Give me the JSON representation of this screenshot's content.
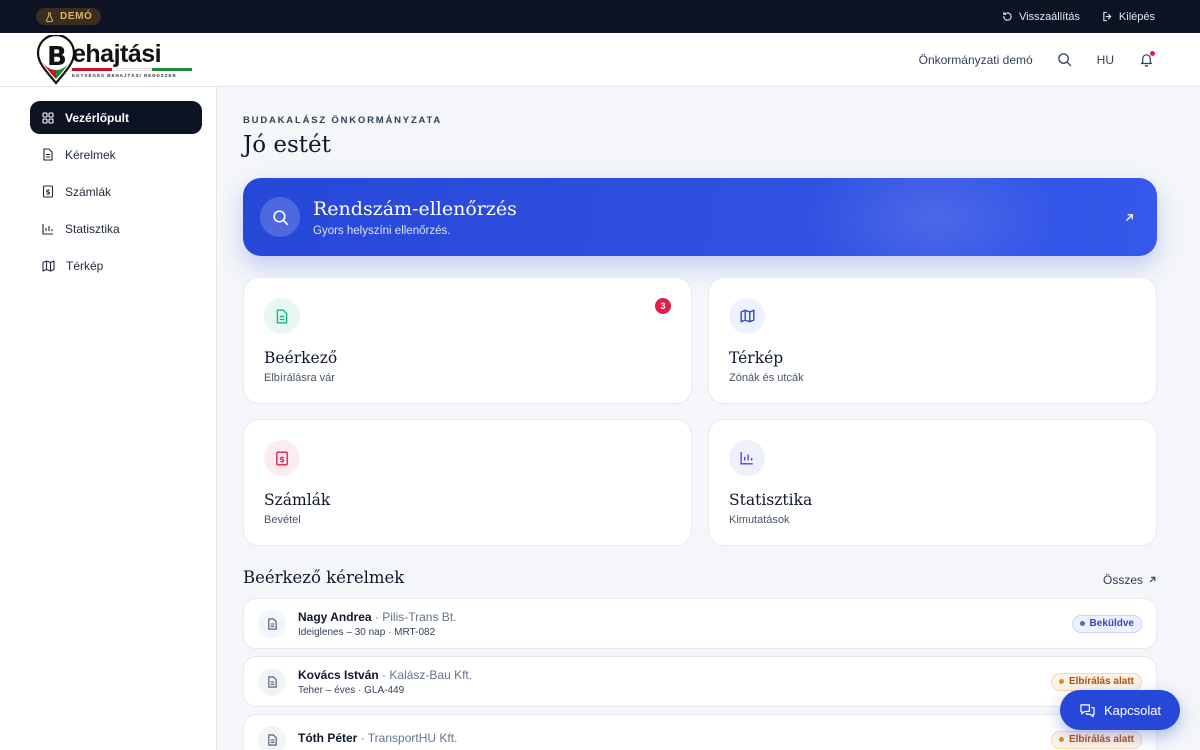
{
  "demobar": {
    "badge": "DEMÓ",
    "reset_label": "Visszaállítás",
    "logout_label": "Kilépés"
  },
  "header": {
    "logo_text": "ehajtási",
    "logo_subtitle": "EGYSÉGES BEHAJTÁSI RENDSZER",
    "account_label": "Önkormányzati demó",
    "language": "HU"
  },
  "sidebar": {
    "items": [
      {
        "label": "Vezérlőpult",
        "icon": "grid-icon",
        "active": true
      },
      {
        "label": "Kérelmek",
        "icon": "document-icon"
      },
      {
        "label": "Számlák",
        "icon": "invoice-icon"
      },
      {
        "label": "Statisztika",
        "icon": "bar-chart-icon"
      },
      {
        "label": "Térkép",
        "icon": "map-icon"
      }
    ]
  },
  "main": {
    "org_name": "BUDAKALÁSZ ÖNKORMÁNYZATA",
    "greeting": "Jó estét",
    "hero": {
      "title": "Rendszám-ellenőrzés",
      "subtitle": "Gyors helyszíni ellenőrzés."
    },
    "cards": [
      {
        "title": "Beérkező",
        "subtitle": "Elbírálásra vár",
        "badge": "3",
        "icon": "document-icon",
        "color": "#10b981"
      },
      {
        "title": "Térkép",
        "subtitle": "Zónák és utcák",
        "icon": "map-icon",
        "color": "#2747d8"
      },
      {
        "title": "Számlák",
        "subtitle": "Bevétel",
        "icon": "invoice-icon",
        "color": "#e11d48"
      },
      {
        "title": "Statisztika",
        "subtitle": "Kimutatások",
        "icon": "bar-chart-icon",
        "color": "#4f46e5"
      }
    ],
    "requests_section": {
      "title": "Beérkező kérelmek",
      "all_label": "Összes"
    },
    "requests": [
      {
        "name": "Nagy Andrea",
        "company": "Pilis-Trans Bt.",
        "details": "Ideiglenes – 30 nap · MRT-082",
        "status": "Beküldve",
        "status_type": "sent"
      },
      {
        "name": "Kovács István",
        "company": "Kalász-Bau Kft.",
        "details": "Teher – éves · GLA-449",
        "status": "Elbírálás alatt",
        "status_type": "review"
      },
      {
        "name": "Tóth Péter",
        "company": "TransportHU Kft.",
        "details": "",
        "status": "Elbírálás alatt",
        "status_type": "review"
      }
    ]
  },
  "contact_button": "Kapcsolat",
  "colors": {
    "accent": "#2747d8",
    "dark": "#0e1324",
    "danger": "#e11d48"
  }
}
